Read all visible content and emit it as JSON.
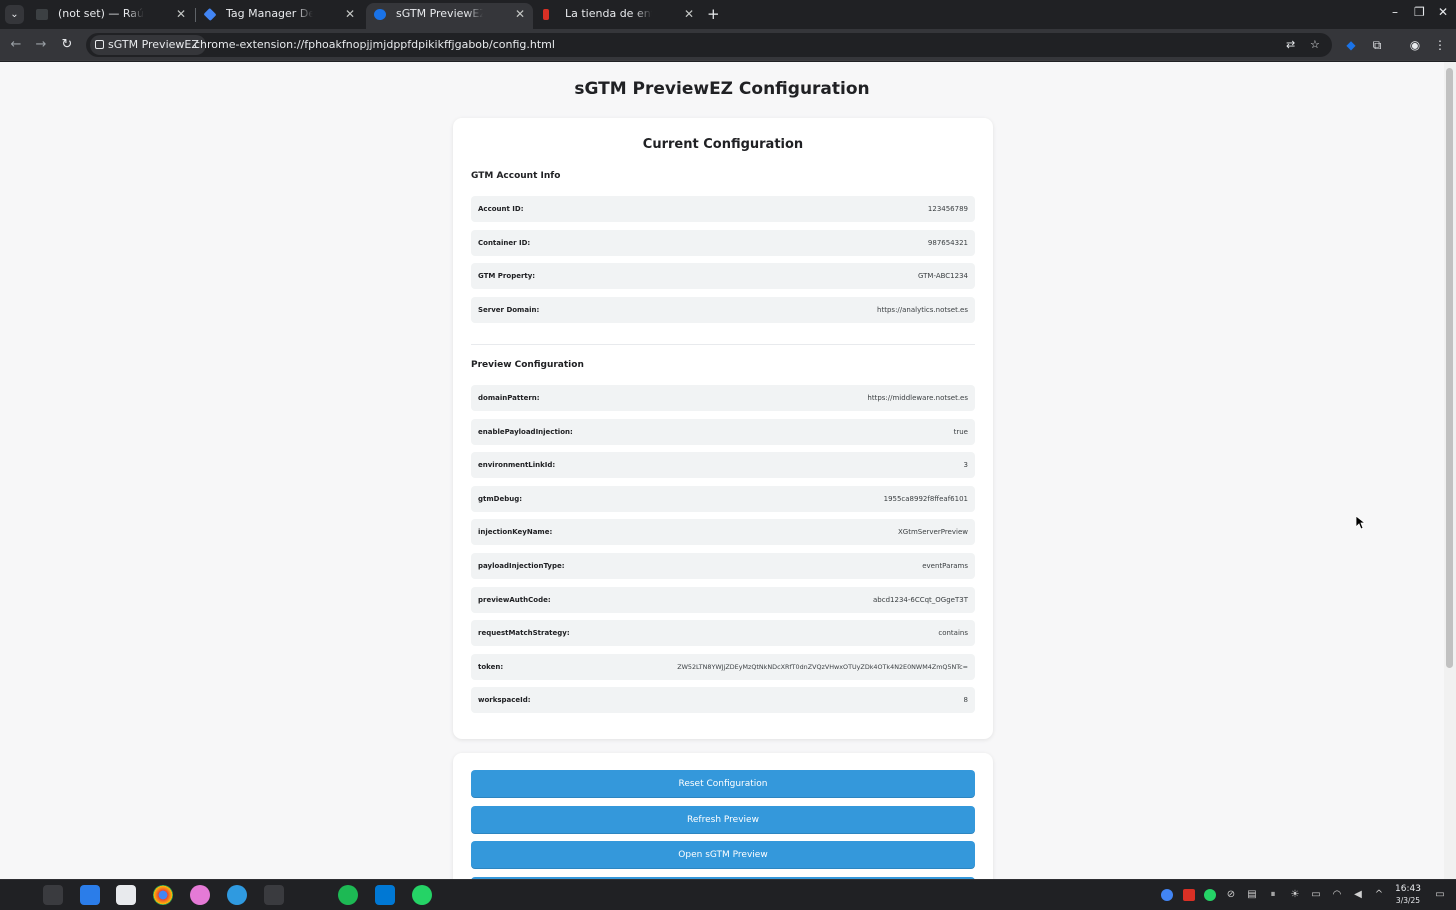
{
  "browser": {
    "tabs": [
      {
        "title": "(not set) — Raúl Fernández",
        "favicon_color": "#3c4043"
      },
      {
        "title": "Tag Manager Debug Mode",
        "favicon_color": "#4285f4"
      },
      {
        "title": "sGTM PreviewEZ Configuration",
        "favicon_color": "#1a73e8"
      },
      {
        "title": "La tienda de entradas de",
        "favicon_color": "#d93025"
      }
    ],
    "site_chip": "sGTM PreviewEZ",
    "url": "chrome-extension://fphoakfnopjjmjdppfdpikikffjgabob/config.html"
  },
  "page": {
    "title": "sGTM PreviewEZ Configuration",
    "card_title": "Current Configuration",
    "account_section": {
      "title": "GTM Account Info",
      "rows": [
        {
          "key": "Account ID:",
          "value": "123456789"
        },
        {
          "key": "Container ID:",
          "value": "987654321"
        },
        {
          "key": "GTM Property:",
          "value": "GTM-ABC1234"
        },
        {
          "key": "Server Domain:",
          "value": "https://analytics.notset.es"
        }
      ]
    },
    "preview_section": {
      "title": "Preview Configuration",
      "rows": [
        {
          "key": "domainPattern:",
          "value": "https://middleware.notset.es"
        },
        {
          "key": "enablePayloadInjection:",
          "value": "true"
        },
        {
          "key": "environmentLinkId:",
          "value": "3"
        },
        {
          "key": "gtmDebug:",
          "value": "1955ca8992f8ffeaf6101"
        },
        {
          "key": "injectionKeyName:",
          "value": "XGtmServerPreview"
        },
        {
          "key": "payloadInjectionType:",
          "value": "eventParams"
        },
        {
          "key": "previewAuthCode:",
          "value": "abcd1234-6CCqt_OGgeT3T"
        },
        {
          "key": "requestMatchStrategy:",
          "value": "contains"
        },
        {
          "key": "token:",
          "value": "ZW52LTN8YWJjZDEyMzQtNkNDcXRfT0dnZVQzVHwxOTUyZDk4OTk4N2E0NWM4ZmQ5NTc="
        },
        {
          "key": "workspaceId:",
          "value": "8"
        }
      ]
    },
    "actions": {
      "reset": "Reset Configuration",
      "refresh": "Refresh Preview",
      "open": "Open sGTM Preview"
    }
  },
  "taskbar": {
    "time": "16:43",
    "date": "3/3/25"
  },
  "colors": {
    "button": "#3498db",
    "row_bg": "#f1f3f4",
    "page_bg": "#f7f7f8",
    "chrome_dark": "#202124"
  }
}
